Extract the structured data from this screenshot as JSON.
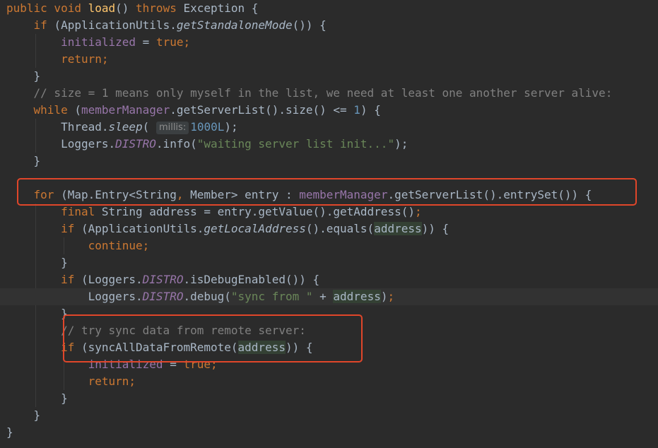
{
  "editor": {
    "lines": [
      {
        "t": [
          [
            "kw",
            "public void "
          ],
          [
            "fn",
            "load"
          ],
          [
            "p",
            "() "
          ],
          [
            "kw",
            "throws "
          ],
          [
            "p",
            "Exception {"
          ]
        ]
      },
      {
        "t": [
          [
            "p",
            "    "
          ],
          [
            "kw",
            "if "
          ],
          [
            "p",
            "(ApplicationUtils."
          ],
          [
            "it",
            "getStandaloneMode"
          ],
          [
            "p",
            "()) {"
          ]
        ]
      },
      {
        "t": [
          [
            "p",
            "        "
          ],
          [
            "fld",
            "initialized"
          ],
          [
            "p",
            " = "
          ],
          [
            "kw",
            "true;"
          ]
        ]
      },
      {
        "t": [
          [
            "p",
            "        "
          ],
          [
            "kw",
            "return;"
          ]
        ]
      },
      {
        "t": [
          [
            "p",
            "    }"
          ]
        ]
      },
      {
        "t": [
          [
            "p",
            "    "
          ],
          [
            "cmt",
            "// size = 1 means only myself in the list, we need at least one another server alive:"
          ]
        ]
      },
      {
        "t": [
          [
            "p",
            "    "
          ],
          [
            "kw",
            "while "
          ],
          [
            "p",
            "("
          ],
          [
            "fld",
            "memberManager"
          ],
          [
            "p",
            ".getServerList().size() <= "
          ],
          [
            "num",
            "1"
          ],
          [
            "p",
            ") {"
          ]
        ]
      },
      {
        "t": [
          [
            "p",
            "        Thread."
          ],
          [
            "it",
            "sleep"
          ],
          [
            "p",
            "( "
          ],
          [
            "hint",
            "millis:"
          ],
          [
            "num",
            "1000L"
          ],
          [
            "p",
            ");"
          ]
        ]
      },
      {
        "t": [
          [
            "p",
            "        Loggers."
          ],
          [
            "sfld",
            "DISTRO"
          ],
          [
            "p",
            ".info("
          ],
          [
            "str",
            "\"waiting server list init...\""
          ],
          [
            "p",
            ");"
          ]
        ]
      },
      {
        "t": [
          [
            "p",
            "    }"
          ]
        ]
      },
      {
        "t": []
      },
      {
        "t": [
          [
            "p",
            "    "
          ],
          [
            "kw",
            "for "
          ],
          [
            "p",
            "(Map.Entry<String"
          ],
          [
            "kw",
            ", "
          ],
          [
            "p",
            "Member> entry : "
          ],
          [
            "fld",
            "memberManager"
          ],
          [
            "p",
            ".getServerList().entrySet()) {"
          ]
        ]
      },
      {
        "t": [
          [
            "p",
            "        "
          ],
          [
            "kw",
            "final "
          ],
          [
            "p",
            "String address = entry.getValue().getAddress()"
          ],
          [
            "kw",
            ";"
          ]
        ]
      },
      {
        "t": [
          [
            "p",
            "        "
          ],
          [
            "kw",
            "if "
          ],
          [
            "p",
            "(ApplicationUtils."
          ],
          [
            "it",
            "getLocalAddress"
          ],
          [
            "p",
            "().equals("
          ],
          [
            "hl",
            "address"
          ],
          [
            "p",
            ")) {"
          ]
        ]
      },
      {
        "t": [
          [
            "p",
            "            "
          ],
          [
            "kw",
            "continue;"
          ]
        ]
      },
      {
        "t": [
          [
            "p",
            "        }"
          ]
        ]
      },
      {
        "t": [
          [
            "p",
            "        "
          ],
          [
            "kw",
            "if "
          ],
          [
            "p",
            "(Loggers."
          ],
          [
            "sfld",
            "DISTRO"
          ],
          [
            "p",
            ".isDebugEnabled()) {"
          ]
        ]
      },
      {
        "t": [
          [
            "p",
            "            Loggers."
          ],
          [
            "sfld",
            "DISTRO"
          ],
          [
            "p",
            ".debug("
          ],
          [
            "str",
            "\"sync from \""
          ],
          [
            "p",
            " + "
          ],
          [
            "hl",
            "addre"
          ],
          [
            "caret",
            ""
          ],
          [
            "hl",
            "ss"
          ],
          [
            "p",
            ")"
          ],
          [
            "kw",
            ";"
          ]
        ],
        "current": true
      },
      {
        "t": [
          [
            "p",
            "        }"
          ]
        ]
      },
      {
        "t": [
          [
            "p",
            "        "
          ],
          [
            "cmt",
            "// try sync data from remote server:"
          ]
        ]
      },
      {
        "t": [
          [
            "p",
            "        "
          ],
          [
            "kw",
            "if "
          ],
          [
            "p",
            "(syncAllDataFromRemote("
          ],
          [
            "hl",
            "address"
          ],
          [
            "p",
            ")) {"
          ]
        ]
      },
      {
        "t": [
          [
            "p",
            "            "
          ],
          [
            "fld",
            "initialized"
          ],
          [
            "p",
            " = "
          ],
          [
            "kw",
            "true;"
          ]
        ]
      },
      {
        "t": [
          [
            "p",
            "            "
          ],
          [
            "kw",
            "return;"
          ]
        ]
      },
      {
        "t": [
          [
            "p",
            "        }"
          ]
        ]
      },
      {
        "t": [
          [
            "p",
            "    }"
          ]
        ]
      },
      {
        "t": [
          [
            "p",
            "}"
          ]
        ]
      }
    ]
  },
  "annotations": {
    "color": "#e0462a",
    "count": 2
  },
  "colors": {
    "background": "#2b2b2b",
    "keyword": "#cc7832",
    "method": "#ffc66d",
    "field": "#9876aa",
    "string": "#6a8759",
    "number": "#6897bb",
    "comment": "#808080",
    "text": "#a9b7c6"
  }
}
